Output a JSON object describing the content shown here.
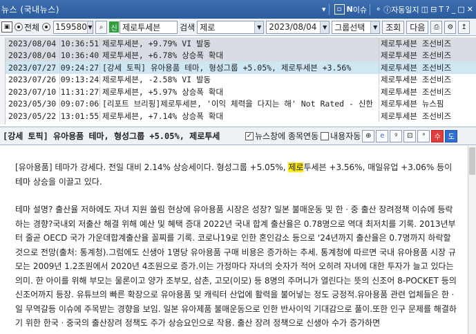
{
  "window": {
    "title": "뉴스 (국내뉴스)",
    "btn_n": "N",
    "btn_issue": "이슈",
    "btn_autolog": "자동일지"
  },
  "toolbar": {
    "radio_all": "전체",
    "code": "159580",
    "tag": "신",
    "stock_name": "제로투세븐",
    "search_label": "검색",
    "search_value": "제로",
    "date": "2023/08/04",
    "group": "그룹선택",
    "query_btn": "조회",
    "next_btn": "다음"
  },
  "news": [
    {
      "date": "2023/08/04",
      "time": "10:36:51",
      "title": "제로투세븐, +9.79% VI 발동",
      "source": "제로투세븐 조선비즈",
      "style": "gray"
    },
    {
      "date": "2023/08/04",
      "time": "10:36:40",
      "title": "제로투세븐, +6.78% 상승폭 확대",
      "source": "제로투세븐 조선비즈",
      "style": "gray"
    },
    {
      "date": "2023/07/27",
      "time": "09:24:27",
      "title": "[강세 토픽] 유아용품 테마, 형성그룹 +5.05%, 제로투세븐 +3.56%",
      "source": "제로투세븐 조선비즈",
      "style": "sel"
    },
    {
      "date": "2023/07/26",
      "time": "09:13:24",
      "title": "제로투세븐, -2.58% VI 발동",
      "source": "제로투세븐 조선비즈",
      "style": ""
    },
    {
      "date": "2023/07/10",
      "time": "11:31:27",
      "title": "제로투세븐, +5.97% 상승폭 확대",
      "source": "제로투세븐 조선비즈",
      "style": ""
    },
    {
      "date": "2023/05/30",
      "time": "09:07:06",
      "title": "[리포트 브리핑]제로투세븐, '이익 체력을 다지는 해' Not Rated - 신한",
      "source": "제로투세븐 뉴스핌",
      "style": ""
    },
    {
      "date": "2023/05/22",
      "time": "13:01:55",
      "title": "제로투세븐, +7.14% 상승폭 확대",
      "source": "제로투세븐 조선비즈",
      "style": ""
    }
  ],
  "headbar": {
    "headline": "[강세 토픽] 유아용품 테마, 형성그룹 +5.05%, 제로투세",
    "link_label": "뉴스창에 종목연동",
    "content_label": "내용자동",
    "btn_up": "수",
    "btn_down": "도"
  },
  "article": {
    "p1_a": "[유아용품] 테마가 강세다. 전일 대비 2.14% 상승세이다. 형성그룹 +5.05%, ",
    "p1_hl": "제로",
    "p1_b": "투세븐 +3.56%, 매일유업 +3.06% 등이 테마 상승을 이끌고 있다.",
    "p2": "테마 설명? 출산율 저하에도 자녀 지원 쏠림 현상에 유아용품 시장은 성장? 일본 불매운동 및 한ㆍ중 출산 장려정책 이슈에 등락하는 경향?국내외 저출산 해결 위해 예산 및 혜택 증대 2022년 국내 합계 출산율은 0.78명으로 역대 최저치를 기록. 2013년부터 줄곧 OECD 국가 가운데합계출산율 꼴찌를 기록. 코로나19로 인한 혼인감소 등으로 '24년까지 출산율은 0.7명까지 하락할 것으로 전망(출처: 통계청).그럼에도 신생아 1명당 유아용품 구매 비용은 증가하는 추세. 통계청에 따르면 국내 유아용품 시장 규모는 2009년 1.2조원에서 2020년 4조원으로 증가.이는 가정마다 자녀의 숫자가 적어 오히려 자녀에 대한 투자가 늘고 있다는 의미. 한 아이를 위해 부모는 물론이고 양가 조부모, 삼촌, 고모(이모) 등 8명의 주머니가 열린다는 뜻의 신조어 8-POCKET 등의 신조어까지 등장. 유튜브의 빠른 확장으로 유아용품 및 캐릭터 산업에 활력을 불어넣는 정도 긍정적.유아용품 관련 업체들은 한ㆍ일 무역갈등 이슈에 주목받는 경향을 보임. 일본 유아제품 불매운동으로 인한 반사이익 기대감으로 풀이.또한 인구 문제를 해결하기 위한 한국ㆍ중국의 출산장려 정책도 주가 상승요인으로 작용. 출산 장려 정책으로 신생아 수가 증가하면"
  },
  "colors": {
    "title_bar": "#2b5c9e",
    "selected_row": "#cfe6f3",
    "gray_row": "#d9dde3",
    "highlight": "#ffe800"
  }
}
